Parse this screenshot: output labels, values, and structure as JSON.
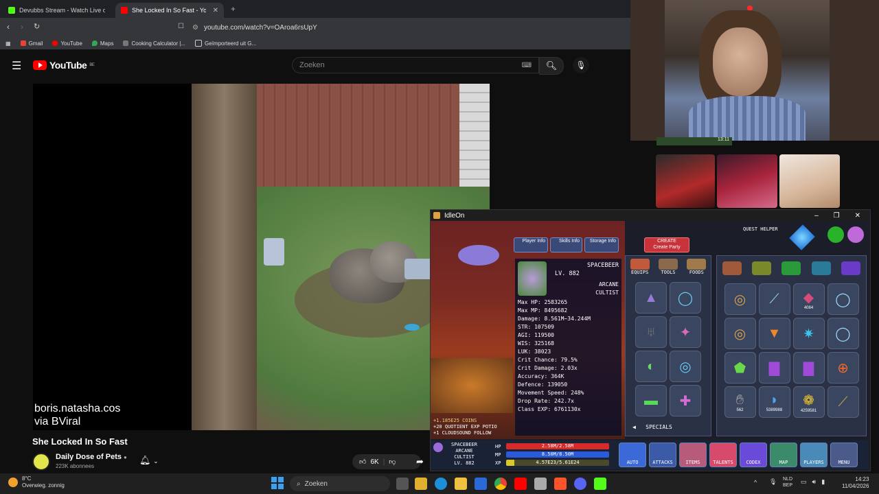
{
  "browser": {
    "tabs": [
      {
        "title": "Devubbs Stream - Watch Live on",
        "color": "#53fc18"
      },
      {
        "title": "She Locked In So Fast - YouT",
        "color": "#ff0000"
      }
    ],
    "url": "youtube.com/watch?v=OAroa6rsUpY",
    "bookmarks": [
      "Gmail",
      "YouTube",
      "Maps",
      "Cooking Calculator |...",
      "Geïmporteerd uit G..."
    ]
  },
  "youtube": {
    "logo": "YouTube",
    "logo_region": "BE",
    "search_placeholder": "Zoeken",
    "video_overlay_line1": "boris.natasha.cos",
    "video_overlay_line2": "via BViral",
    "video_title": "She Locked In So Fast",
    "channel_name": "Daily Dose of Pets",
    "subscribers": "223K abonnees",
    "likes": "6K"
  },
  "stream_overlay": {
    "timer": "13:11"
  },
  "game": {
    "window_title": "IdleOn",
    "quest_helper": "QUEST HELPER",
    "top_buttons": [
      "Player Info",
      "Skills Info",
      "Storage Info"
    ],
    "create_party": "Create Party",
    "create_party_top": "CREATE",
    "character": {
      "name": "SPACEBEER",
      "level": "LV. 882",
      "class_line1": "ARCANE",
      "class_line2": "CULTIST"
    },
    "stats": [
      "Max HP: 2583265",
      "Max MP: 8495682",
      "Damage: 8.561M~34.244M",
      "STR: 107509",
      "AGI: 119500",
      "WIS: 325168",
      "LUK: 38023",
      "Crit Chance: 79.5%",
      "Crit Damage: 2.03x",
      "Accuracy: 364K",
      "Defence: 139050",
      "Movement Speed: 248%",
      "Drop Rate: 242.7x",
      "Class EXP: 6761130x"
    ],
    "coins_text": "+1.185E25 COINS",
    "log_line1": "+20 QUOTIENT EXP POTIO",
    "log_line2": "+1 CLOUDSOUND FOLLOW",
    "inventory_tabs": [
      "EQUIPS",
      "TOOLS",
      "FOODS"
    ],
    "specials": "SPECIALS",
    "item_counts": [
      "4084",
      "562",
      "5389988",
      "4259581"
    ],
    "hud": {
      "name": "SPACEBEER",
      "class_line1": "ARCANE",
      "class_line2": "CULTIST",
      "level": "LV. 882",
      "hp_label": "HP",
      "mp_label": "MP",
      "xp_label": "XP",
      "hp_text": "2.58M/2.58M",
      "mp_text": "8.50M/8.50M",
      "xp_text": "4.57E23/5.61E24",
      "buttons": [
        "AUTO",
        "ATTACKS",
        "ITEMS",
        "TALENTS",
        "CODEX",
        "MAP",
        "PLAYERS",
        "MENU"
      ]
    }
  },
  "taskbar": {
    "temperature": "8°C",
    "weather": "Overwieg. zonnig",
    "search_placeholder": "Zoeken",
    "lang1": "NLD",
    "lang2": "BEP",
    "time": "14:23",
    "date": "11/04/2026"
  }
}
